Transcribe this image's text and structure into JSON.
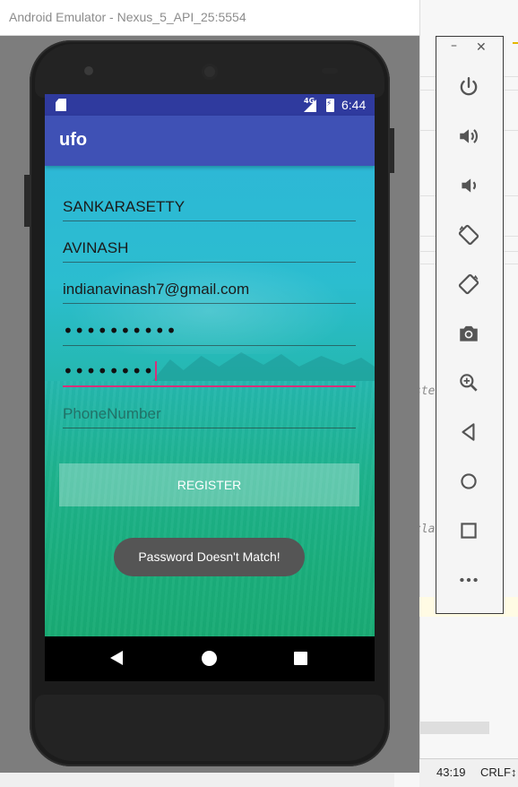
{
  "window": {
    "title": "Android Emulator - Nexus_5_API_25:5554"
  },
  "status_bar": {
    "network": "4G",
    "time": "6:44"
  },
  "app": {
    "title": "ufo"
  },
  "form": {
    "last_name": "SANKARASETTY",
    "first_name": "AVINASH",
    "email": "indianavinash7@gmail.com",
    "password_mask": "••••••••••",
    "confirm_password_mask": "••••••••",
    "phone_placeholder": "PhoneNumber",
    "register_label": "REGISTER"
  },
  "toast": {
    "message": "Password Doesn't Match!"
  },
  "emulator_toolbar": {
    "minimize_label": "–",
    "close_label": "✕",
    "buttons": [
      "power-icon",
      "volume-up-icon",
      "volume-down-icon",
      "rotate-left-icon",
      "rotate-right-icon",
      "camera-icon",
      "zoom-icon",
      "back-icon",
      "home-icon",
      "overview-icon",
      "more-icon"
    ]
  },
  "ide": {
    "code_fragment_1": "ste",
    "code_fragment_2": "cla",
    "cursor_position": "43:19",
    "line_separator": "CRLF↕"
  },
  "colors": {
    "status_bar": "#2f3a9e",
    "app_bar": "#3f51b5",
    "accent_underline": "#d8307a",
    "toast_bg": "#555555"
  }
}
